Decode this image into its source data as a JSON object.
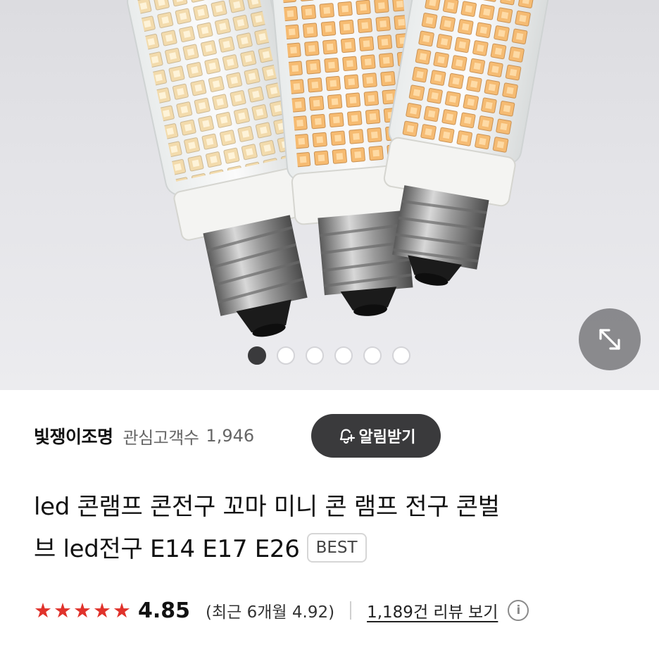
{
  "gallery": {
    "dot_count": 6,
    "active_index": 0,
    "expand_icon": "expand-arrows-icon"
  },
  "seller": {
    "name": "빛쟁이조명",
    "followers_label": "관심고객수",
    "followers_count": "1,946",
    "alarm_button": "알림받기",
    "alarm_icon": "bell-plus-icon"
  },
  "product": {
    "title_line1": "led 콘램프 콘전구 꼬마 미니 콘 램프 전구 콘벌",
    "title_line2": "브 led전구 E14 E17 E26",
    "badge": "BEST"
  },
  "rating": {
    "stars_filled": 5,
    "score": "4.85",
    "recent": "(최근 6개월 4.92)",
    "review_link": "1,189건 리뷰 보기",
    "info_icon": "info-icon",
    "star_color": "#e0322b"
  },
  "colors": {
    "button_dark": "#3a3a3c",
    "badge_border": "#d6d6d6"
  }
}
